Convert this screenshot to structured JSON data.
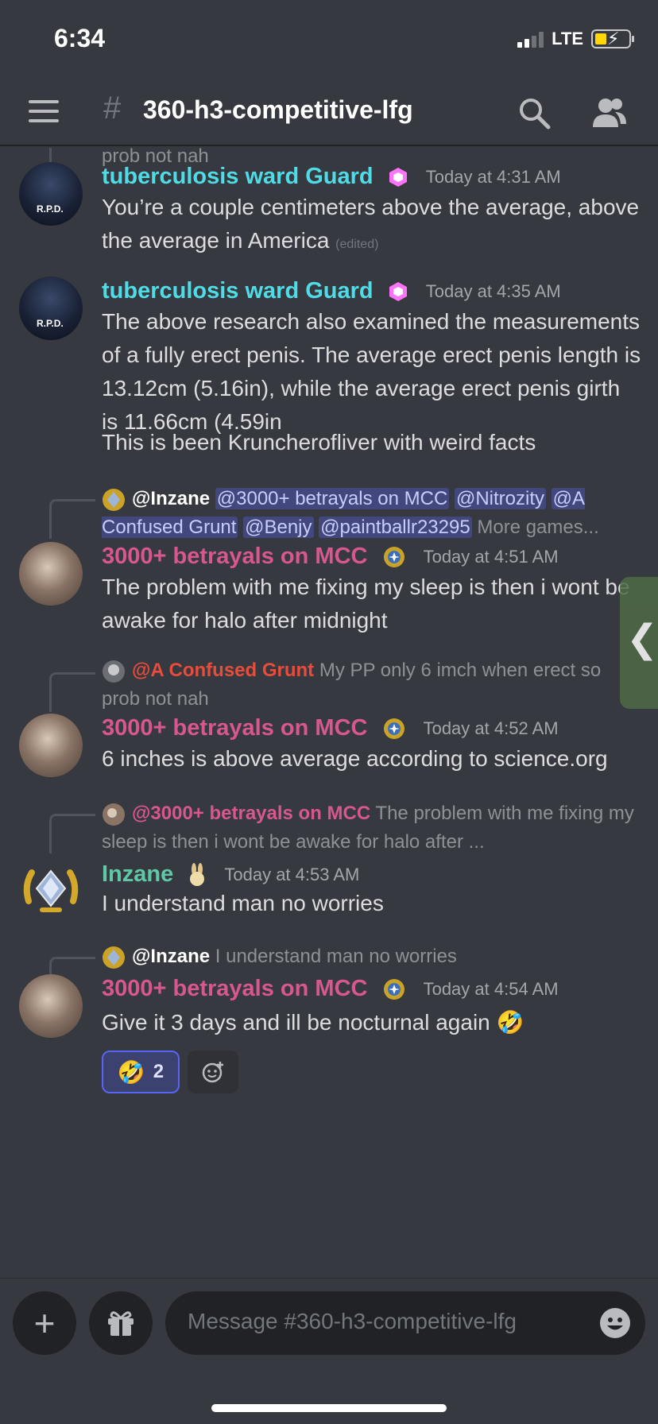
{
  "status_bar": {
    "time": "6:34",
    "network": "LTE"
  },
  "header": {
    "channel_name": "360-h3-competitive-lfg",
    "hash_symbol": "#",
    "icons": [
      "menu-icon",
      "channel-hash-icon",
      "search-icon",
      "members-icon"
    ]
  },
  "messages": [
    {
      "type": "continuation",
      "text": "prob not nah"
    },
    {
      "author": "tuberculosis ward Guard",
      "author_color": "#4fdce6",
      "timestamp": "Today at 4:31 AM",
      "text": "You’re a couple centimeters above the average, above the average in America",
      "edited": "(edited)"
    },
    {
      "author": "tuberculosis ward Guard",
      "author_color": "#4fdce6",
      "timestamp": "Today at 4:35 AM",
      "text": "The above research also examined the measurements of a fully erect penis. The average erect penis length is 13.12cm (5.16in), while the average erect penis girth is 11.66cm (4.59in",
      "text2": "This is been Kruncherofliver with weird facts"
    },
    {
      "reply": {
        "name": "@Inzane",
        "mentions": [
          "@3000+ betrayals on MCC",
          "@Nitrozity",
          "@A Confused Grunt",
          "@Benjy",
          "@paintballr23295"
        ],
        "suffix": "More games..."
      },
      "author": "3000+ betrayals on MCC",
      "author_color": "#d8578e",
      "timestamp": "Today at 4:51 AM",
      "text": "The problem with me fixing my sleep is then i wont be awake for halo after midnight"
    },
    {
      "reply": {
        "name": "@A Confused Grunt",
        "text": "My PP only 6 imch when erect so prob not nah"
      },
      "author": "3000+ betrayals on MCC",
      "author_color": "#d8578e",
      "timestamp": "Today at 4:52 AM",
      "text": "6 inches is above average according to science.org"
    },
    {
      "reply": {
        "name": "@3000+ betrayals on MCC",
        "text": "The problem with me fixing my sleep is then i wont be awake for halo after ..."
      },
      "author": "Inzane",
      "author_color": "#5fc9a7",
      "timestamp": "Today at 4:53 AM",
      "text": "I understand man no worries"
    },
    {
      "reply": {
        "name": "@Inzane",
        "text": "I understand man no worries"
      },
      "author": "3000+ betrayals on MCC",
      "author_color": "#d8578e",
      "timestamp": "Today at 4:54 AM",
      "text": "Give it 3 days and ill be nocturnal again 🤣",
      "reactions": [
        {
          "emoji": "🤣",
          "count": "2",
          "active": true
        }
      ]
    }
  ],
  "side_tab_glyph": "❮",
  "composer": {
    "placeholder": "Message #360-h3-competitive-lfg",
    "plus": "+"
  },
  "colors": {
    "background": "#36393f",
    "mention_bg": "#3c4270",
    "accent": "#5865f2"
  }
}
